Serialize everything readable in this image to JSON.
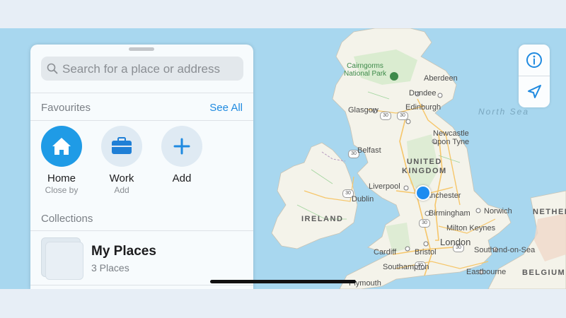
{
  "panel": {
    "search": {
      "placeholder": "Search for a place or address",
      "icon": "search-icon"
    },
    "favourites": {
      "title": "Favourites",
      "see_all": "See All",
      "items": [
        {
          "name": "Home",
          "sub": "Close by",
          "icon": "house-icon",
          "color": "#1f9be6"
        },
        {
          "name": "Work",
          "sub": "Add",
          "icon": "briefcase-icon",
          "color": "#1f7fd6"
        },
        {
          "name": "Add",
          "sub": "",
          "icon": "plus-icon",
          "color": "#1f8ae0"
        }
      ]
    },
    "collections": {
      "title": "Collections",
      "items": [
        {
          "title": "My Places",
          "sub": "3 Places"
        }
      ]
    }
  },
  "map": {
    "labels": {
      "cairngorms": "Cairngorms\nNational Park",
      "aberdeen": "Aberdeen",
      "dundee": "Dundee",
      "glasgow": "Glasgow",
      "edinburgh": "Edinburgh",
      "north_sea": "North Sea",
      "newcastle": "Newcastle\nupon Tyne",
      "belfast": "Belfast",
      "united_kingdom": "UNITED\nKINGDOM",
      "liverpool": "Liverpool",
      "manchester": "Manchester",
      "dublin": "Dublin",
      "ireland": "IRELAND",
      "birmingham": "Birmingham",
      "norwich": "Norwich",
      "milton_keynes": "Milton Keynes",
      "london": "London",
      "cardiff": "Cardiff",
      "bristol": "Bristol",
      "southend": "Southend-on-Sea",
      "eastbourne": "Eastbourne",
      "southampton": "Southampton",
      "plymouth": "Plymouth",
      "netherlands": "NETHER",
      "belgium": "BELGIUM"
    },
    "colors": {
      "water": "#a8d7ef",
      "land": "#f4f3ea",
      "green": "#cfe8c4",
      "urban": "#f0d8c9",
      "road": "#f6c66a",
      "accent": "#1d8cf0"
    }
  },
  "controls": {
    "info": "info-icon",
    "location": "location-arrow-icon"
  }
}
